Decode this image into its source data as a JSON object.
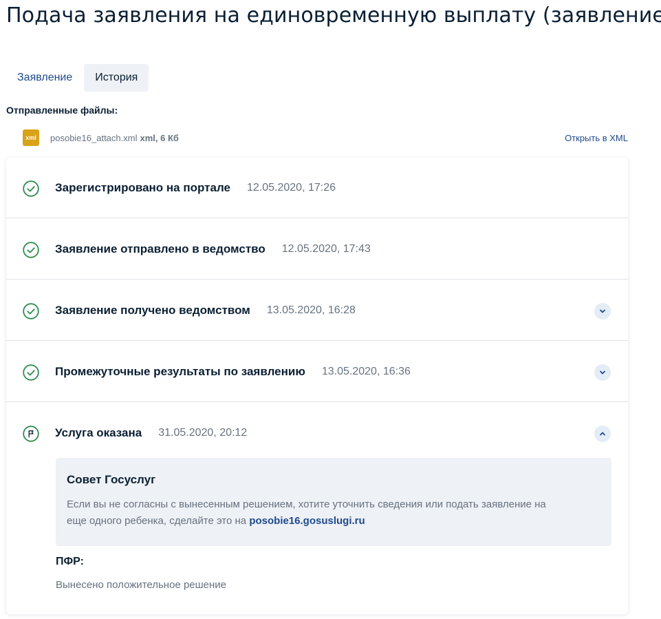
{
  "page": {
    "title": "Подача заявления на единовременную выплату (заявление №"
  },
  "tabs": [
    {
      "label": "Заявление",
      "active": false
    },
    {
      "label": "История",
      "active": true
    }
  ],
  "files": {
    "label": "Отправленные файлы:",
    "items": [
      {
        "badge": "xml",
        "name": "posobie16_attach.xml",
        "meta": "xml, 6 Кб",
        "open_label": "Открыть в XML"
      }
    ]
  },
  "history": [
    {
      "title": "Зарегистрировано на портале",
      "date": "12.05.2020, 17:26",
      "icon": "check-circle-icon",
      "toggle": "none"
    },
    {
      "title": "Заявление отправлено в ведомство",
      "date": "12.05.2020, 17:43",
      "icon": "check-circle-icon",
      "toggle": "none"
    },
    {
      "title": "Заявление получено ведомством",
      "date": "13.05.2020, 16:28",
      "icon": "check-circle-icon",
      "toggle": "expand"
    },
    {
      "title": "Промежуточные результаты по заявлению",
      "date": "13.05.2020, 16:36",
      "icon": "check-circle-icon",
      "toggle": "expand"
    },
    {
      "title": "Услуга оказана",
      "date": "31.05.2020, 20:12",
      "icon": "flag-circle-icon",
      "toggle": "collapse"
    }
  ],
  "advice": {
    "title": "Совет Госуслуг",
    "text_line1": "Если вы не согласны с вынесенным решением, хотите уточнить сведения или подать заявление на",
    "text_line2_prefix": "еще одного ребенка, сделайте это на",
    "link": "posobie16.gosuslugi.ru"
  },
  "pfr": {
    "label": "ПФР:",
    "text": "Вынесено положительное решение"
  },
  "colors": {
    "accent_link": "#1f4a8d",
    "success_green": "#2c8c4c",
    "xml_badge": "#d8a219",
    "advice_bg": "#eef1f5"
  }
}
